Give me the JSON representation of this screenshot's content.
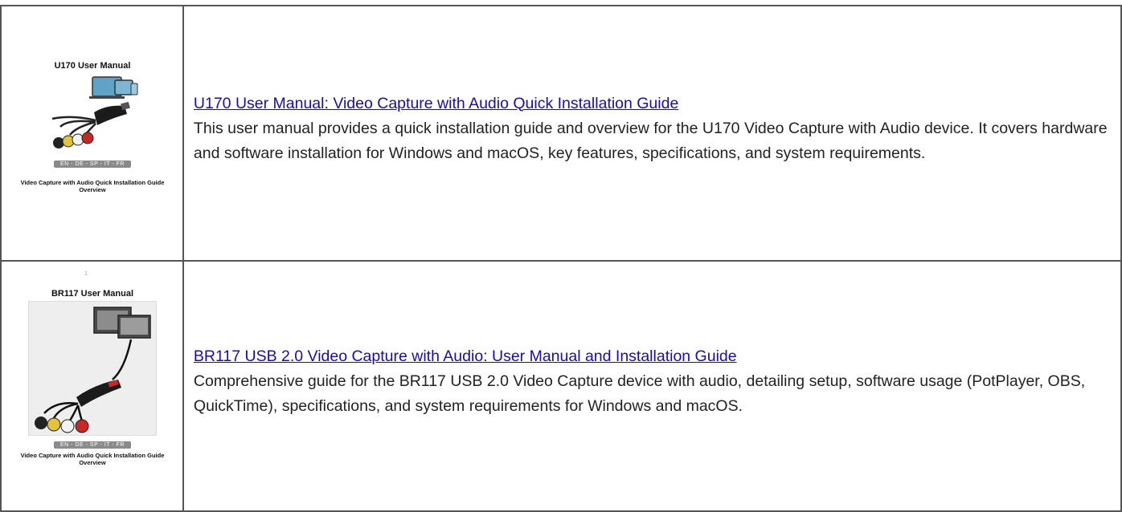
{
  "items": [
    {
      "cover_title": "U170 User Manual",
      "cover_lang": "EN - DE - SP - IT - FR",
      "cover_caption": "Video Capture with Audio Quick Installation Guide Overview",
      "link_text": "U170 User Manual: Video Capture with Audio Quick Installation Guide",
      "description": "This user manual provides a quick installation guide and overview for the U170 Video Capture with Audio device. It covers hardware and software installation for Windows and macOS, key features, specifications, and system requirements."
    },
    {
      "page_mark": "1",
      "cover_title": "BR117 User Manual",
      "cover_lang": "EN - DE - SP - IT - FR",
      "cover_caption": "Video Capture with Audio Quick Installation Guide Overview",
      "link_text": "BR117 USB 2.0 Video Capture with Audio: User Manual and Installation Guide",
      "description": "Comprehensive guide for the BR117 USB 2.0 Video Capture device with audio, detailing setup, software usage (PotPlayer, OBS, QuickTime), specifications, and system requirements for Windows and macOS."
    }
  ],
  "colors": {
    "link": "#1a0dab",
    "border": "#555555",
    "lang_bar": "#8a8a8a"
  }
}
